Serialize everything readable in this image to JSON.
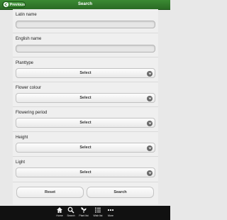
{
  "header": {
    "back_label": "Previous",
    "title": "Search",
    "colors": {
      "bar": "#2f7a29",
      "text": "#ffffff"
    }
  },
  "form": {
    "latin_name": {
      "label": "Latin name",
      "value": ""
    },
    "english_name": {
      "label": "English name",
      "value": ""
    },
    "plant_type": {
      "label": "Planttype",
      "selected": "Select"
    },
    "flower_colour": {
      "label": "Flower colour",
      "selected": "Select"
    },
    "flowering_period": {
      "label": "Flowering period",
      "selected": "Select"
    },
    "height": {
      "label": "Height",
      "selected": "Select"
    },
    "light": {
      "label": "Light",
      "selected": "Select"
    }
  },
  "actions": {
    "reset_label": "Reset",
    "search_label": "Search"
  },
  "nav": {
    "items": [
      {
        "label": "Home",
        "icon": "home-icon"
      },
      {
        "label": "Search",
        "icon": "search-icon"
      },
      {
        "label": "Plant list",
        "icon": "plant-icon"
      },
      {
        "label": "Wish list",
        "icon": "list-icon"
      },
      {
        "label": "More",
        "icon": "more-icon"
      }
    ]
  }
}
